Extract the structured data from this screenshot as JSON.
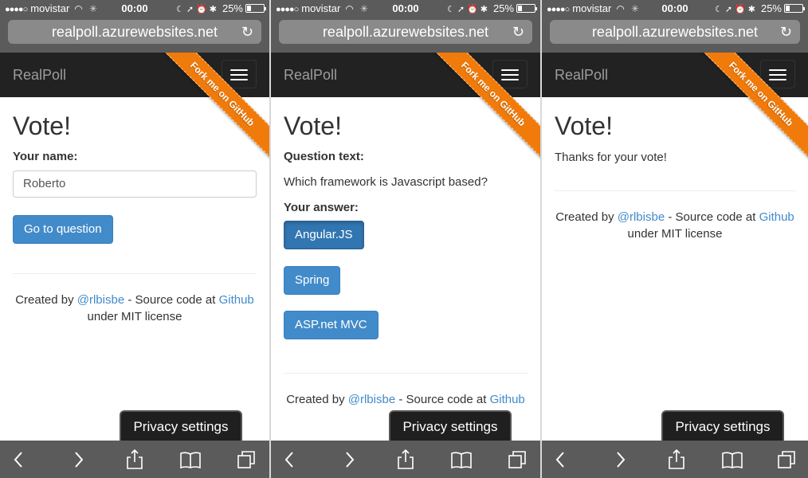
{
  "status": {
    "carrier": "movistar",
    "time": "00:00",
    "battery": "25%"
  },
  "browser": {
    "url": "realpoll.azurewebsites.net",
    "privacy_label": "Privacy settings"
  },
  "navbar": {
    "brand": "RealPoll",
    "ribbon": "Fork me on GitHub"
  },
  "screens": [
    {
      "title": "Vote!",
      "name_label": "Your name:",
      "name_value": "Roberto",
      "button": "Go to question"
    },
    {
      "title": "Vote!",
      "question_label": "Question text:",
      "question_text": "Which framework is Javascript based?",
      "answer_label": "Your answer:",
      "answers": [
        "Angular.JS",
        "Spring",
        "ASP.net MVC"
      ]
    },
    {
      "title": "Vote!",
      "thanks": "Thanks for your vote!"
    }
  ],
  "footer": {
    "created_by": "Created by",
    "author": "@rlbisbe",
    "source_text": "- Source code at",
    "github": "Github",
    "license": "under MIT license",
    "license_cut": "under"
  }
}
